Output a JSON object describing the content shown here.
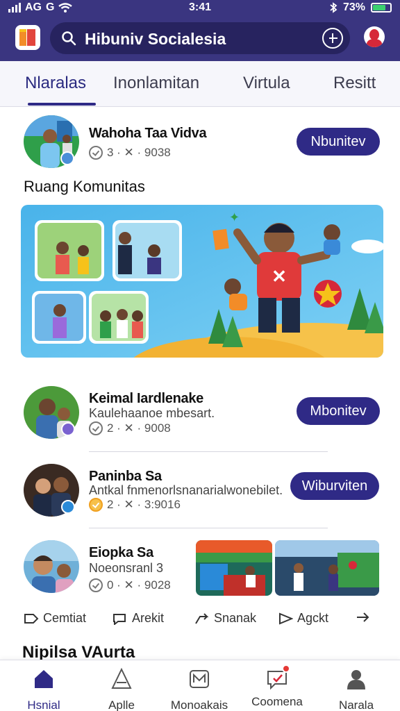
{
  "status_bar": {
    "carrier": "AG",
    "network_label": "G",
    "time": "3:41",
    "battery_percent": "73%",
    "battery_level": 0.73
  },
  "header": {
    "search_text": "Hibuniv Socialesia",
    "logo_icon": "app-logo-icon",
    "filter_icon": "add-filter-icon",
    "profile_icon": "profile-icon"
  },
  "tabs": [
    {
      "label": "Nlaralas",
      "active": true
    },
    {
      "label": "Inonlamitan",
      "active": false
    },
    {
      "label": "Virtula",
      "active": false
    },
    {
      "label": "Resitt",
      "active": false
    }
  ],
  "feed": {
    "item1": {
      "title": "Wahoha Taa Vidva",
      "meta": "3 · ✕ · 9038",
      "button": "Nbunitev"
    },
    "section_title": "Ruang Komunitas",
    "item2": {
      "title": "Keimal Iardlenake",
      "subtitle": "Kaulehaanoe mbesart.",
      "meta": "2 · ✕ · 9008",
      "button": "Mbonitev"
    },
    "item3": {
      "title": "Paninba Sa",
      "subtitle": "Antkal fnmenorlsnanarialwonebilet.",
      "meta": "2 · ✕ · 3:9016",
      "button": "Wiburviten"
    },
    "item4": {
      "title": "Eiopka Sa",
      "subtitle": "Noeonsranl 3",
      "meta": "0 · ✕ · 9028"
    }
  },
  "actions": [
    {
      "label": "Cemtiat",
      "icon": "comment-icon"
    },
    {
      "label": "Arekit",
      "icon": "reply-icon"
    },
    {
      "label": "Snanak",
      "icon": "share-icon"
    },
    {
      "label": "Agckt",
      "icon": "repost-icon"
    },
    {
      "label": "",
      "icon": "forward-icon"
    }
  ],
  "next_section": "Nipilsa VAurta",
  "bottom_nav": [
    {
      "label": "Hsnial",
      "icon": "home-icon",
      "active": true
    },
    {
      "label": "Aplle",
      "icon": "triangle-icon",
      "active": false
    },
    {
      "label": "Monoakais",
      "icon": "mail-icon",
      "active": false
    },
    {
      "label": "Coomena",
      "icon": "chat-icon",
      "active": false,
      "badge": true
    },
    {
      "label": "Narala",
      "icon": "user-icon",
      "active": false
    }
  ],
  "colors": {
    "brand": "#3a3580",
    "button": "#2f2a86",
    "accent_red": "#d62839"
  }
}
